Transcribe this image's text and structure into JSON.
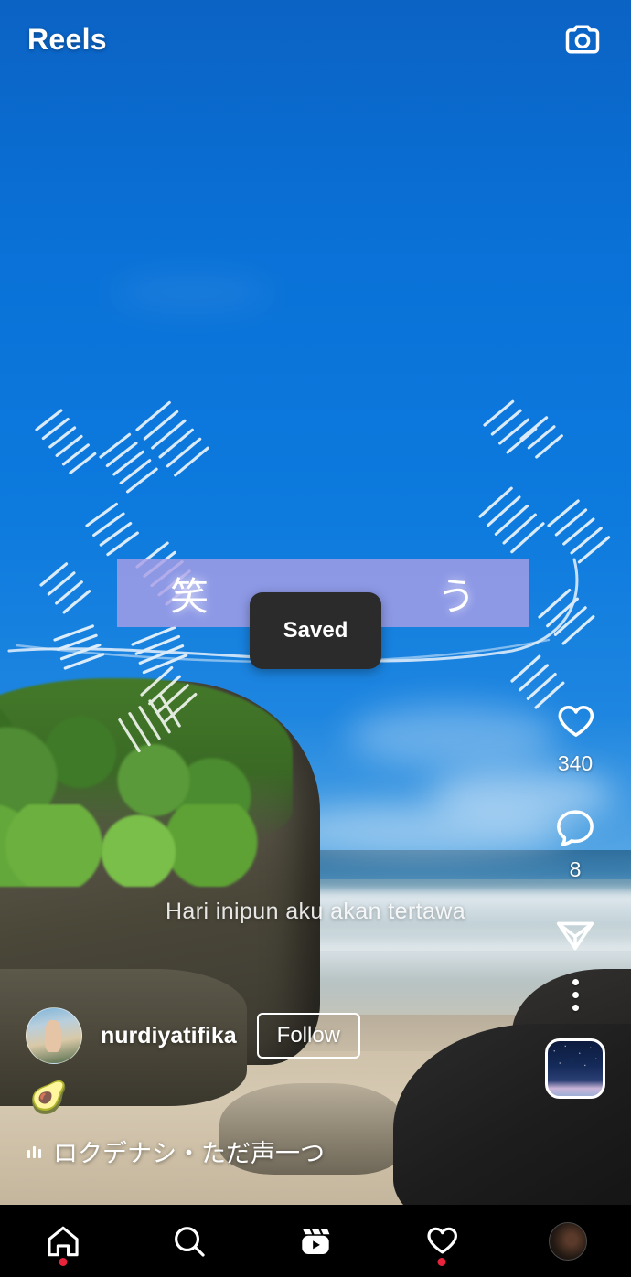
{
  "header": {
    "title": "Reels",
    "camera_icon": "camera-icon"
  },
  "video": {
    "overlay_text": {
      "left": "笑",
      "right": "う"
    },
    "subtitle": "Hari inipun aku akan tertawa",
    "sticker_emoji": "🥑"
  },
  "toast": {
    "message": "Saved"
  },
  "actions": {
    "like": {
      "icon": "heart-icon",
      "count": "340"
    },
    "comment": {
      "icon": "comment-icon",
      "count": "8"
    },
    "share": {
      "icon": "share-icon"
    },
    "more": {
      "icon": "more-options-icon"
    },
    "audio_thumbnail": "audio-cover-thumbnail"
  },
  "user": {
    "username": "nurdiyatifika",
    "follow_label": "Follow",
    "avatar": "user-avatar"
  },
  "audio": {
    "icon": "music-waveform-icon",
    "title": "ロクデナシ・ただ声一つ"
  },
  "nav": {
    "items": [
      {
        "name": "home",
        "icon": "home-icon",
        "badge": true
      },
      {
        "name": "search",
        "icon": "search-icon",
        "badge": false
      },
      {
        "name": "reels",
        "icon": "reels-icon",
        "badge": false
      },
      {
        "name": "activity",
        "icon": "heart-icon",
        "badge": true
      },
      {
        "name": "profile",
        "icon": "profile-avatar-icon",
        "badge": false
      }
    ]
  },
  "colors": {
    "sky_blue": "#0a72d8",
    "banner_purple": "#a89fe6",
    "toast_bg": "#2b2b2b",
    "badge_red": "#e8243c",
    "nav_bg": "#000000",
    "text_white": "#ffffff"
  }
}
